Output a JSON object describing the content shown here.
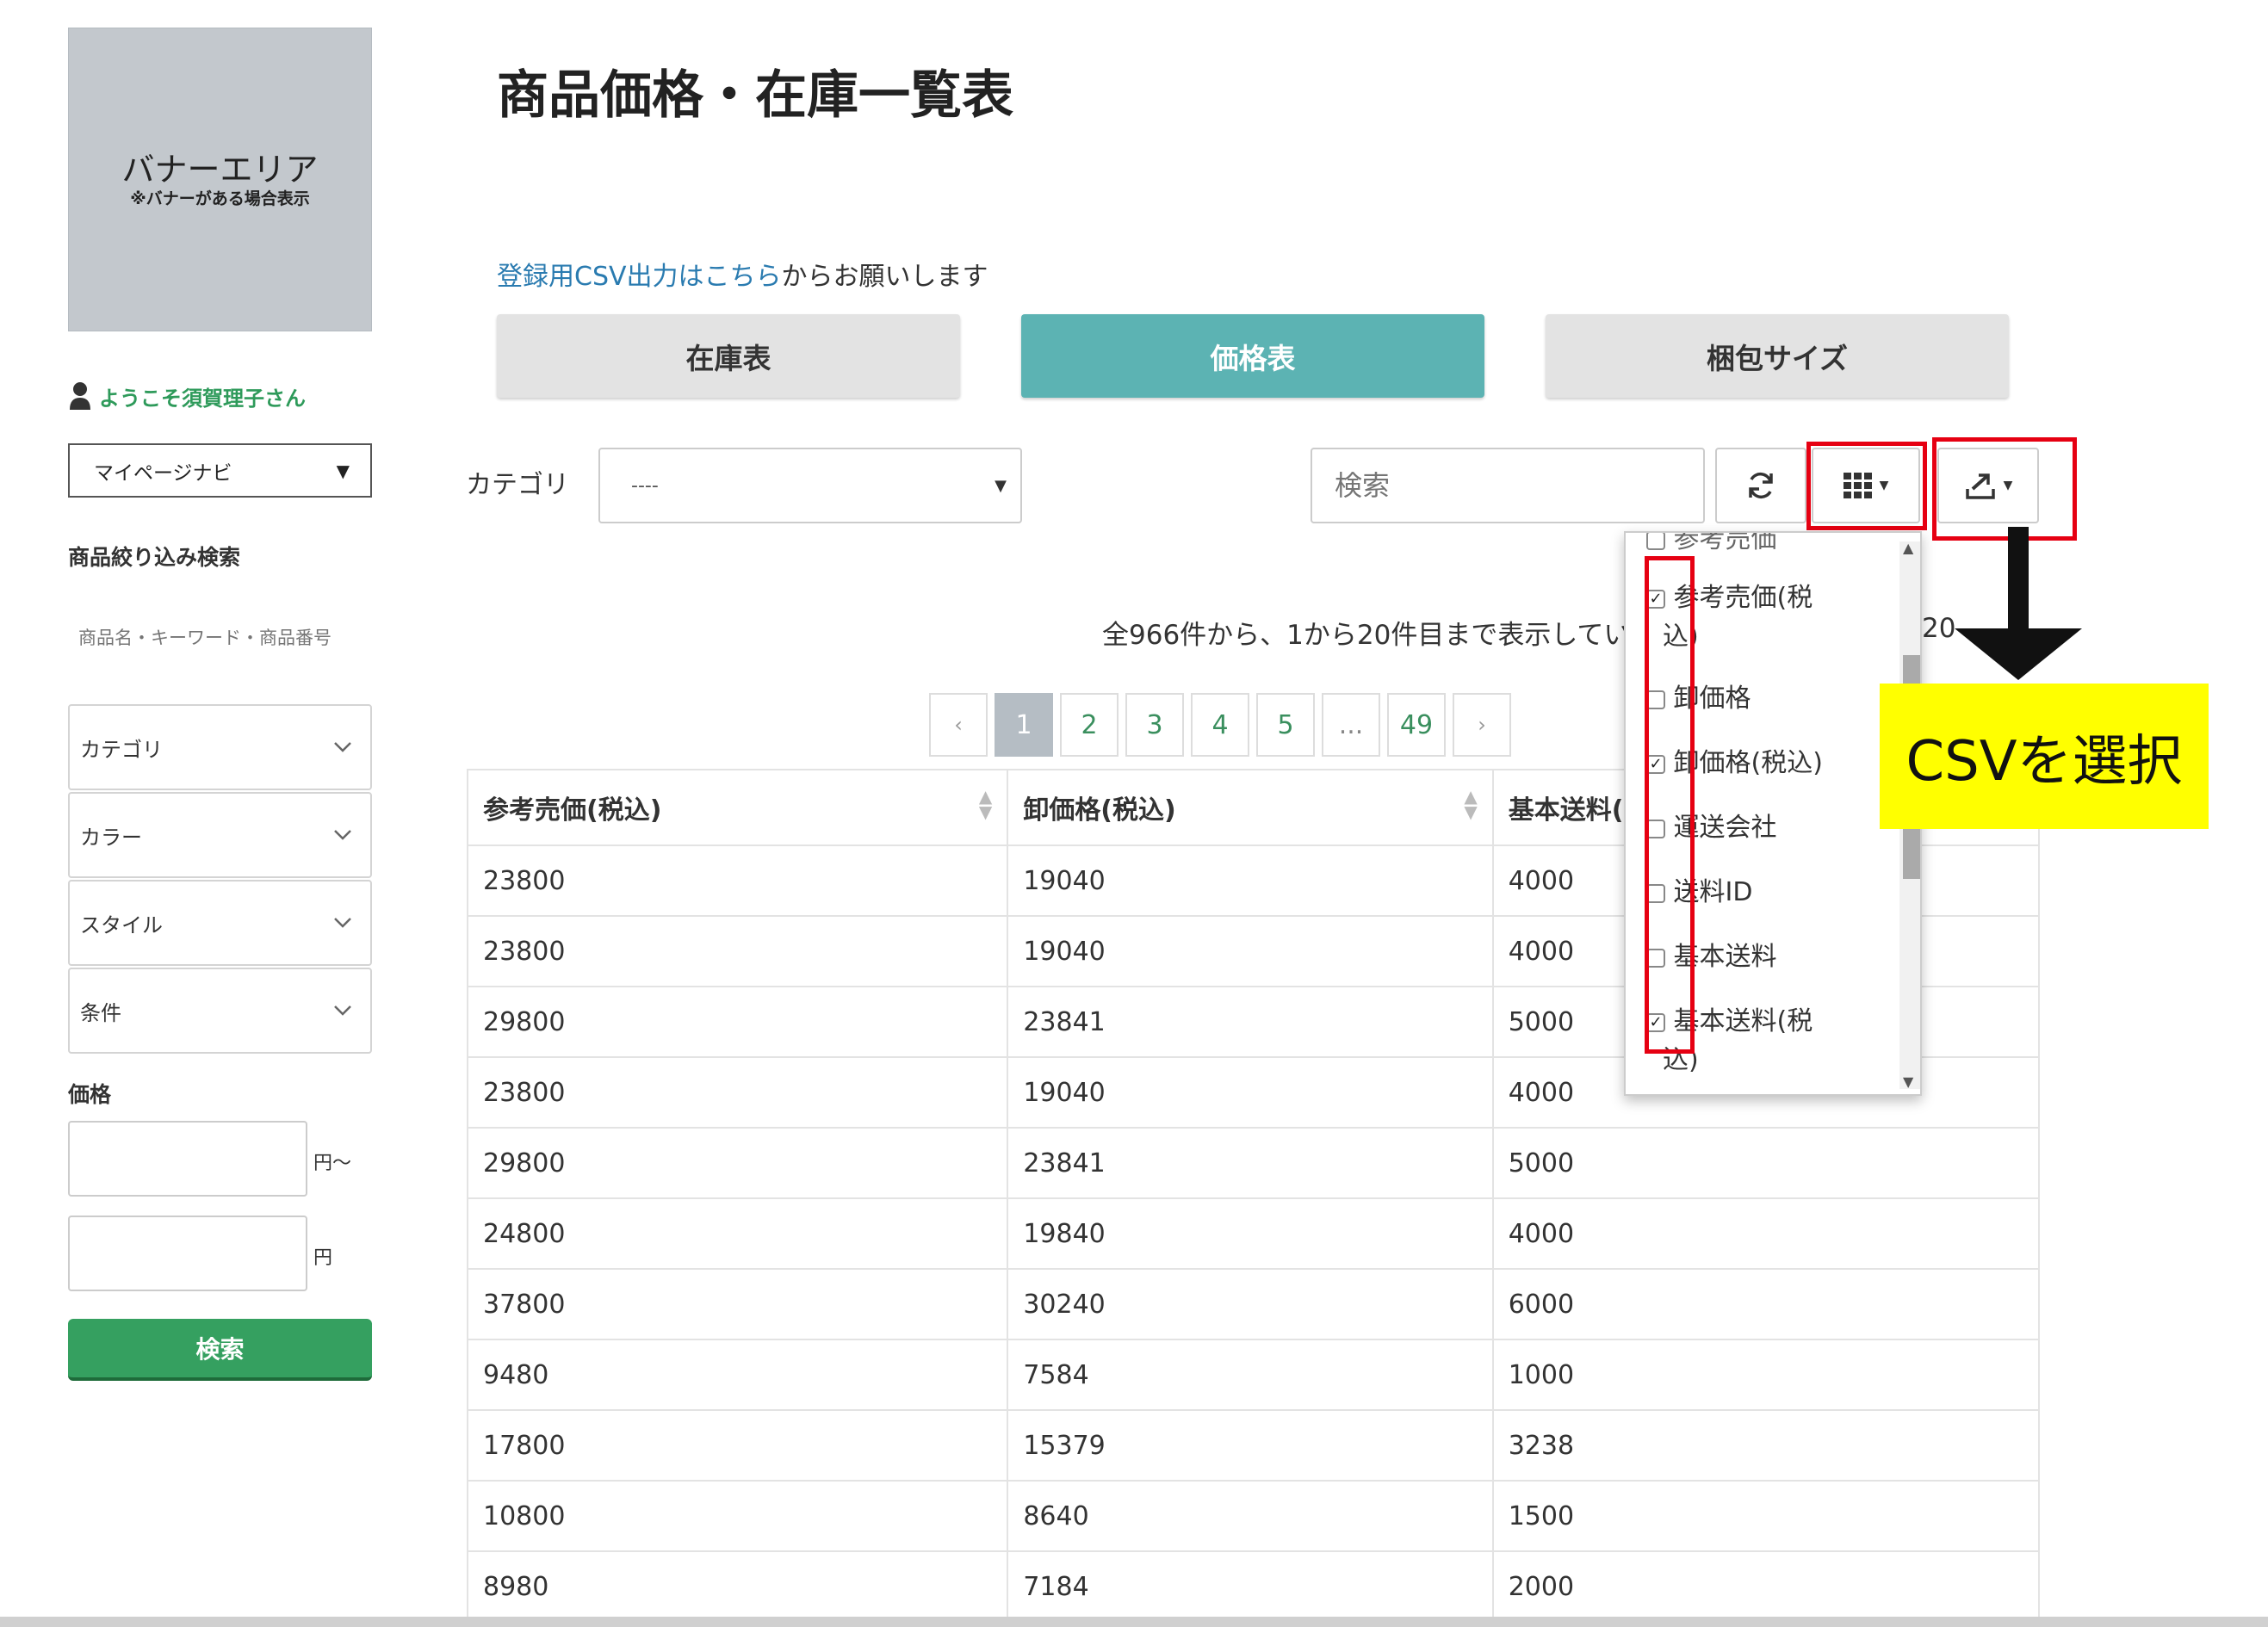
{
  "sidebar": {
    "banner_title": "バナーエリア",
    "banner_note": "※バナーがある場合表示",
    "welcome": "ようこそ須賀理子さん",
    "mypage_nav": "マイページナビ",
    "filter_heading": "商品絞り込み検索",
    "keyword_placeholder": "商品名・キーワード・商品番号",
    "filters": [
      "カテゴリ",
      "カラー",
      "スタイル",
      "条件"
    ],
    "price_heading": "価格",
    "price_from_suffix": "円〜",
    "price_to_suffix": "円",
    "search_button": "検索"
  },
  "main": {
    "title": "商品価格・在庫一覧表",
    "csv_note_link": "登録用CSV出力はこちら",
    "csv_note_rest": "からお願いします",
    "tabs": [
      "在庫表",
      "価格表",
      "梱包サイズ"
    ],
    "active_tab": "価格表",
    "category_label": "カテゴリ",
    "category_value": "----",
    "search_placeholder": "検索",
    "results_info": "全966件から、1から20件目まで表示してい",
    "per_page": "20",
    "pagination": [
      "‹",
      "1",
      "2",
      "3",
      "4",
      "5",
      "...",
      "49",
      "›"
    ],
    "current_page": "1"
  },
  "table": {
    "headers": [
      "参考売価(税込)",
      "卸価格(税込)",
      "基本送料("
    ],
    "rows": [
      [
        "23800",
        "19040",
        "4000"
      ],
      [
        "23800",
        "19040",
        "4000"
      ],
      [
        "29800",
        "23841",
        "5000"
      ],
      [
        "23800",
        "19040",
        "4000"
      ],
      [
        "29800",
        "23841",
        "5000"
      ],
      [
        "24800",
        "19840",
        "4000"
      ],
      [
        "37800",
        "30240",
        "6000"
      ],
      [
        "9480",
        "7584",
        "1000"
      ],
      [
        "17800",
        "15379",
        "3238"
      ],
      [
        "10800",
        "8640",
        "1500"
      ],
      [
        "8980",
        "7184",
        "2000"
      ]
    ]
  },
  "columns_dropdown": {
    "partial_top": "参考売価",
    "items": [
      {
        "label": "参考売価(税",
        "wrap": "込)",
        "checked": true
      },
      {
        "label": "卸価格",
        "checked": false
      },
      {
        "label": "卸価格(税込)",
        "checked": true
      },
      {
        "label": "運送会社",
        "checked": false
      },
      {
        "label": "送料ID",
        "checked": false
      },
      {
        "label": "基本送料",
        "checked": false
      },
      {
        "label": "基本送料(税",
        "wrap": "込)",
        "checked": true
      }
    ]
  },
  "annotation": {
    "callout": "CSVを選択",
    "highlight_color": "#e60012",
    "callout_color": "#ffff00"
  },
  "colors": {
    "accent_teal": "#5cb3b3",
    "green": "#35a060",
    "link_blue": "#2a7bb0"
  }
}
